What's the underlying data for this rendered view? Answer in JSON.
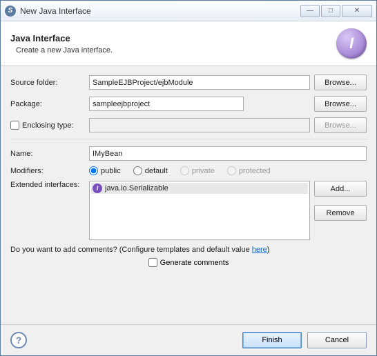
{
  "window": {
    "title": "New Java Interface"
  },
  "header": {
    "title": "Java Interface",
    "subtitle": "Create a new Java interface.",
    "icon_letter": "I"
  },
  "form": {
    "source_folder": {
      "label": "Source folder:",
      "value": "SampleEJBProject/ejbModule",
      "browse": "Browse..."
    },
    "package": {
      "label": "Package:",
      "value": "sampleejbproject",
      "browse": "Browse..."
    },
    "enclosing": {
      "label": "Enclosing type:",
      "value": "",
      "browse": "Browse..."
    },
    "name": {
      "label": "Name:",
      "value": "IMyBean"
    },
    "modifiers": {
      "label": "Modifiers:",
      "options": {
        "public": "public",
        "default": "default",
        "private": "private",
        "protected": "protected"
      },
      "selected": "public"
    },
    "extended": {
      "label": "Extended interfaces:",
      "items": [
        "java.io.Serializable"
      ],
      "add": "Add...",
      "remove": "Remove"
    },
    "comments": {
      "question": "Do you want to add comments? (Configure templates and default value ",
      "link": "here",
      "after": ")",
      "generate": "Generate comments"
    }
  },
  "footer": {
    "finish": "Finish",
    "cancel": "Cancel"
  }
}
